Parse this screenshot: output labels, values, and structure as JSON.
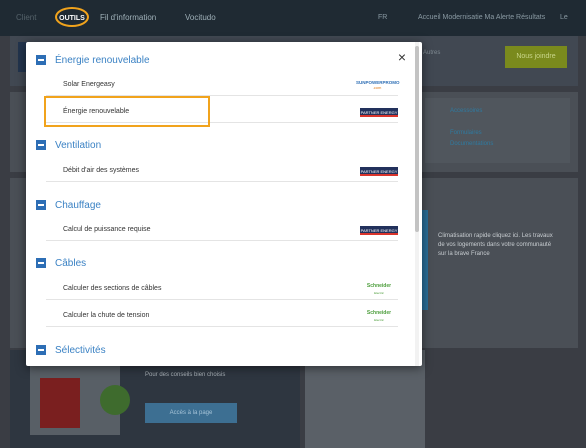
{
  "topbar": {
    "nav": [
      "Client",
      "OUTILS",
      "Fil d'information",
      "Vocitudo"
    ],
    "right": [
      "FR",
      "Accueil Modernisatie Ma Alerte Résultats",
      "Le"
    ]
  },
  "background": {
    "green_button": "Nous joindre",
    "pill_text": "Autres",
    "bullets": [
      "Accessoires",
      "Formulaires",
      "Documentations"
    ],
    "right_text": "Climatisation rapide cliquez ici. Les travaux de vos logements dans votre communauté sur la brave France",
    "caption": "Pour des conseils bien choisis",
    "blue_button": "Accès à la page"
  },
  "modal": {
    "close_label": "×",
    "sections": [
      {
        "title": "Énergie renouvelable",
        "rows": [
          {
            "label": "Solar Energeasy",
            "logo": "sunpower-logo"
          },
          {
            "label": "Énergie renouvelable",
            "logo": "pe-badge"
          }
        ]
      },
      {
        "title": "Ventilation",
        "rows": [
          {
            "label": "Débit d'air des systèmes",
            "logo": "pe-badge"
          }
        ]
      },
      {
        "title": "Chauffage",
        "rows": [
          {
            "label": "Calcul de puissance requise",
            "logo": "pe-badge"
          }
        ]
      },
      {
        "title": "Câbles",
        "rows": [
          {
            "label": "Calculer des sections de câbles",
            "logo": "schneider-logo"
          },
          {
            "label": "Calculer la chute de tension",
            "logo": "schneider-logo"
          }
        ]
      },
      {
        "title": "Sélectivités",
        "rows": []
      }
    ],
    "logos": {
      "pe": "PARTNER ENERGY",
      "schneider_top": "Schneider",
      "schneider_bottom": "Electric",
      "sunpower_top": "SUNPOWERPROMO",
      "sunpower_bottom": ".com"
    }
  },
  "colors": {
    "accent": "#3b82c4",
    "highlight": "#f1a31c",
    "schneider_green": "#4b9d3a"
  }
}
